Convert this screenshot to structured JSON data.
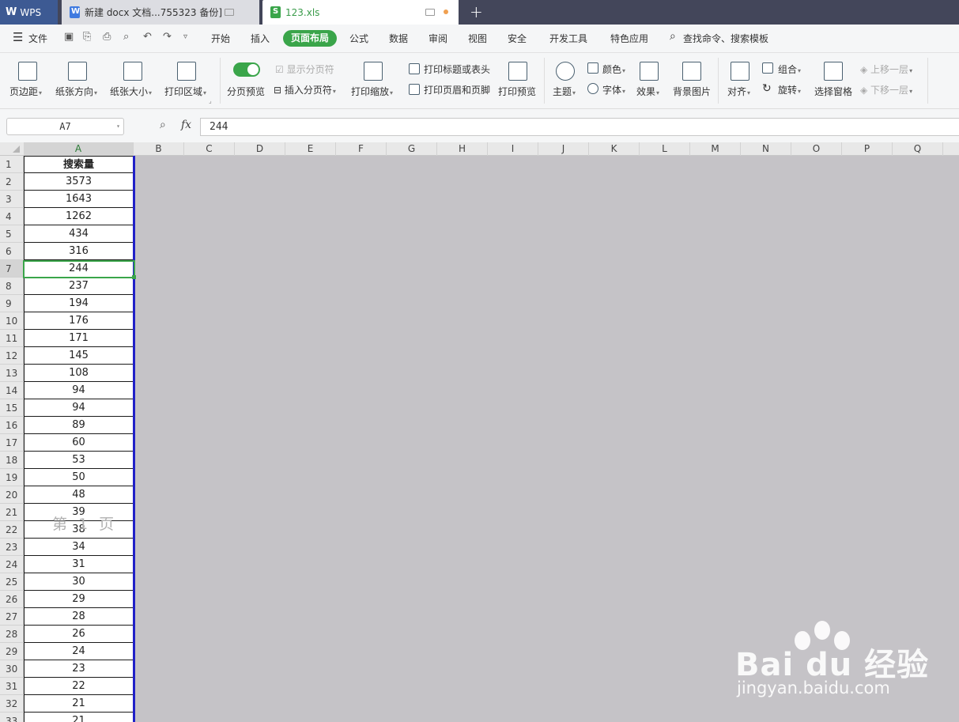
{
  "tabs": {
    "wps": "WPS",
    "doc": "新建 docx 文档...755323 备份]",
    "xls": "123.xls"
  },
  "menu": {
    "file": "文件",
    "items": [
      "开始",
      "插入",
      "页面布局",
      "公式",
      "数据",
      "审阅",
      "视图",
      "安全",
      "开发工具",
      "特色应用"
    ],
    "active": "页面布局",
    "search": "查找命令、搜索模板"
  },
  "ribbon": {
    "margins": "页边距",
    "orientation": "纸张方向",
    "size": "纸张大小",
    "print_area": "打印区域",
    "page_break_preview": "分页预览",
    "show_page_breaks": "显示分页符",
    "insert_page_break": "插入分页符",
    "print_scale": "打印缩放",
    "print_titles": "打印标题或表头",
    "header_footer": "打印页眉和页脚",
    "print_preview": "打印预览",
    "theme": "主题",
    "colors": "颜色",
    "fonts": "字体",
    "effects": "效果",
    "background": "背景图片",
    "align": "对齐",
    "group": "组合",
    "rotate": "旋转",
    "selection_pane": "选择窗格",
    "bring_forward": "上移一层",
    "send_backward": "下移一层"
  },
  "formula_bar": {
    "cell_ref": "A7",
    "fx": "fx",
    "value": "244"
  },
  "columns": [
    "A",
    "B",
    "C",
    "D",
    "E",
    "F",
    "G",
    "H",
    "I",
    "J",
    "K",
    "L",
    "M",
    "N",
    "O",
    "P",
    "Q"
  ],
  "rows": [
    "1",
    "2",
    "3",
    "4",
    "5",
    "6",
    "7",
    "8",
    "9",
    "10",
    "11",
    "12",
    "13",
    "14",
    "15",
    "16",
    "17",
    "18",
    "19",
    "20",
    "21",
    "22",
    "23",
    "24",
    "25",
    "26",
    "27",
    "28",
    "29",
    "30",
    "31",
    "32",
    "33"
  ],
  "column_a": [
    "搜索量",
    "3573",
    "1643",
    "1262",
    "434",
    "316",
    "244",
    "237",
    "194",
    "176",
    "171",
    "145",
    "108",
    "94",
    "94",
    "89",
    "60",
    "53",
    "50",
    "48",
    "39",
    "38",
    "34",
    "31",
    "30",
    "29",
    "28",
    "26",
    "24",
    "23",
    "22",
    "21",
    "21"
  ],
  "page_label": "第 1 页",
  "watermark": {
    "logo": "Bai du 经验",
    "url": "jingyan.baidu.com"
  }
}
